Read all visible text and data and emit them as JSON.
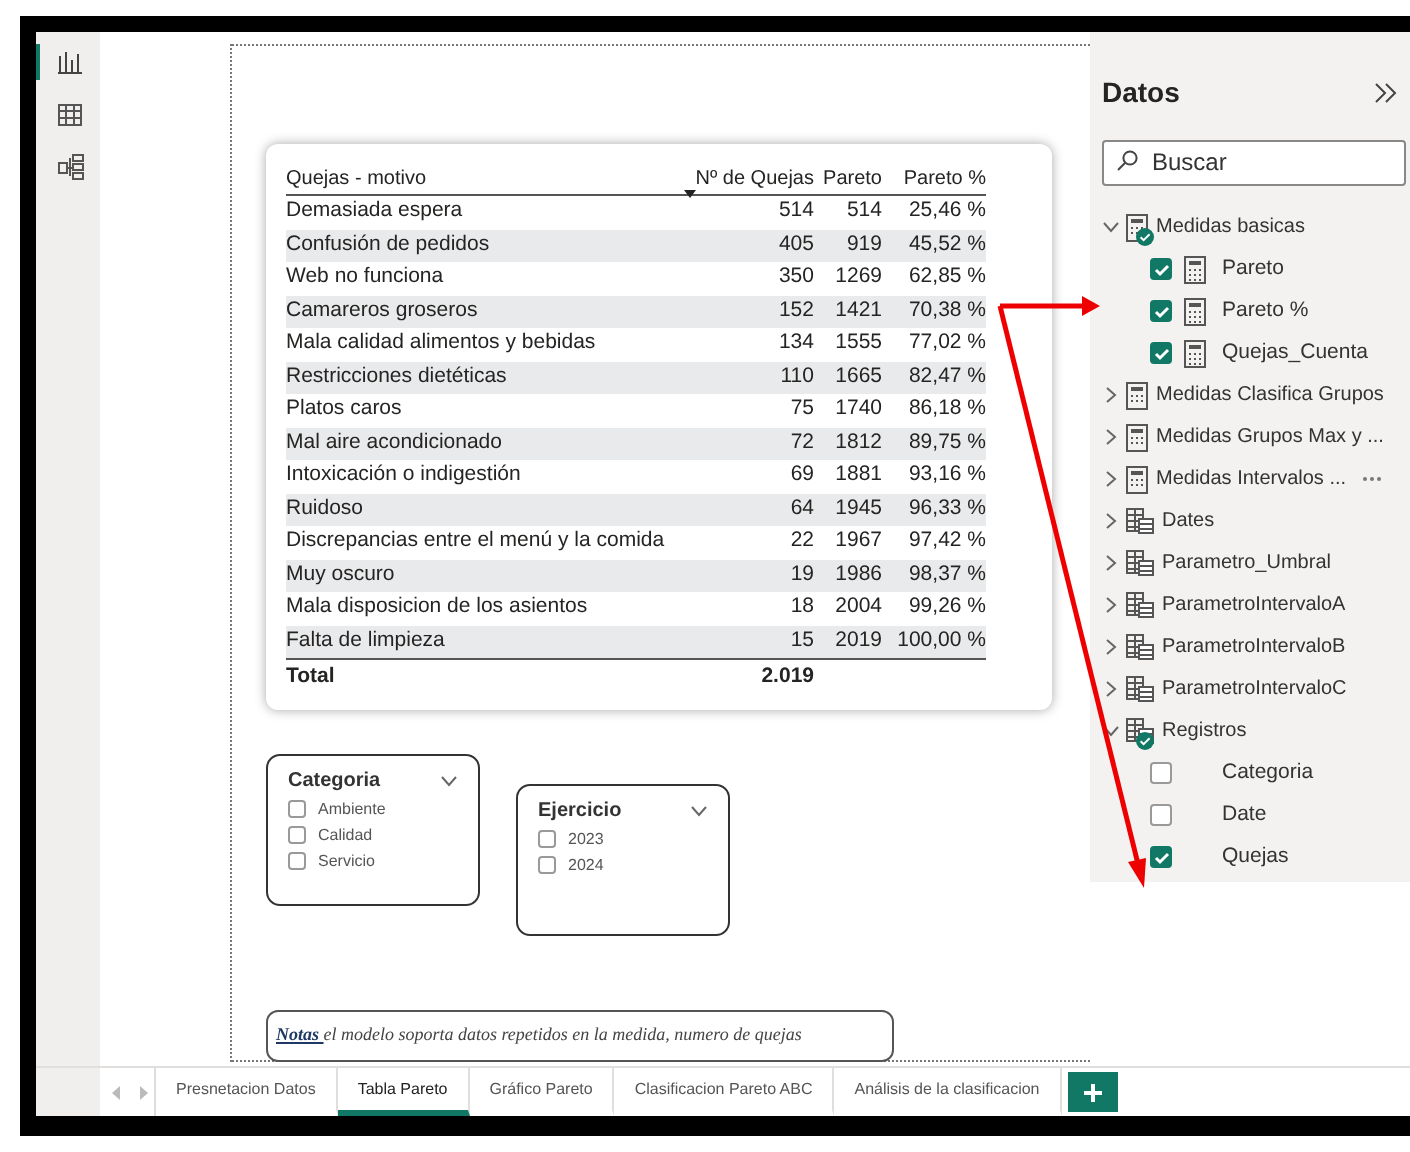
{
  "view_rail": [
    {
      "kind": "report",
      "selected": true
    },
    {
      "kind": "table",
      "selected": false
    },
    {
      "kind": "model",
      "selected": false
    }
  ],
  "table": {
    "columns": [
      "Quejas - motivo",
      "Nº de Quejas",
      "Pareto",
      "Pareto %"
    ],
    "rows": [
      [
        "Demasiada espera",
        "514",
        "514",
        "25,46 %"
      ],
      [
        "Confusión de pedidos",
        "405",
        "919",
        "45,52 %"
      ],
      [
        "Web no funciona",
        "350",
        "1269",
        "62,85 %"
      ],
      [
        "Camareros groseros",
        "152",
        "1421",
        "70,38 %"
      ],
      [
        "Mala calidad alimentos y bebidas",
        "134",
        "1555",
        "77,02 %"
      ],
      [
        "Restricciones dietéticas",
        "110",
        "1665",
        "82,47 %"
      ],
      [
        "Platos caros",
        "75",
        "1740",
        "86,18 %"
      ],
      [
        "Mal aire acondicionado",
        "72",
        "1812",
        "89,75 %"
      ],
      [
        "Intoxicación o indigestión",
        "69",
        "1881",
        "93,16 %"
      ],
      [
        "Ruidoso",
        "64",
        "1945",
        "96,33 %"
      ],
      [
        "Discrepancias entre el menú y la comida",
        "22",
        "1967",
        "97,42 %"
      ],
      [
        "Muy oscuro",
        "19",
        "1986",
        "98,37 %"
      ],
      [
        "Mala disposicion de los asientos",
        "18",
        "2004",
        "99,26 %"
      ],
      [
        "Falta de limpieza",
        "15",
        "2019",
        "100,00 %"
      ]
    ],
    "total": {
      "label": "Total",
      "value": "2.019"
    }
  },
  "slicers": [
    {
      "title": "Categoria",
      "items": [
        {
          "label": "Ambiente",
          "checked": false
        },
        {
          "label": "Calidad",
          "checked": false
        },
        {
          "label": "Servicio",
          "checked": false
        }
      ]
    },
    {
      "title": "Ejercicio",
      "items": [
        {
          "label": "2023",
          "checked": false
        },
        {
          "label": "2024",
          "checked": false
        }
      ]
    }
  ],
  "note": {
    "lead": "Notas ",
    "text": "el modelo soporta datos repetidos en la medida, numero de quejas"
  },
  "page_tabs": [
    {
      "label": "Presnetacion Datos",
      "selected": false
    },
    {
      "label": "Tabla Pareto",
      "selected": true
    },
    {
      "label": "Gráfico Pareto",
      "selected": false
    },
    {
      "label": "Clasificacion Pareto ABC",
      "selected": false
    },
    {
      "label": "Análisis de la clasificacion",
      "selected": false
    }
  ],
  "data_pane": {
    "title": "Datos",
    "search": {
      "placeholder": "Buscar"
    },
    "tree": [
      {
        "label": "Medidas basicas",
        "kind": "measures",
        "expanded": true,
        "in_use": true,
        "children": [
          {
            "label": "Pareto",
            "kind": "measure",
            "checked": true
          },
          {
            "label": "Pareto %",
            "kind": "measure",
            "checked": true
          },
          {
            "label": "Quejas_Cuenta",
            "kind": "measure",
            "checked": true
          }
        ]
      },
      {
        "label": "Medidas Clasifica Grupos",
        "kind": "measures",
        "expanded": false,
        "in_use": false
      },
      {
        "label": "Medidas Grupos Max y ...",
        "kind": "measures",
        "expanded": false,
        "in_use": false
      },
      {
        "label": "Medidas Intervalos ...",
        "kind": "measures",
        "expanded": false,
        "in_use": false,
        "more": true
      },
      {
        "label": "Dates",
        "kind": "table",
        "expanded": false,
        "in_use": false
      },
      {
        "label": "Parametro_Umbral",
        "kind": "table",
        "expanded": false,
        "in_use": false
      },
      {
        "label": "ParametroIntervaloA",
        "kind": "table",
        "expanded": false,
        "in_use": false
      },
      {
        "label": "ParametroIntervaloB",
        "kind": "table",
        "expanded": false,
        "in_use": false
      },
      {
        "label": "ParametroIntervaloC",
        "kind": "table",
        "expanded": false,
        "in_use": false
      },
      {
        "label": "Registros",
        "kind": "table",
        "expanded": true,
        "in_use": true,
        "children": [
          {
            "label": "Categoria",
            "kind": "column",
            "checked": false
          },
          {
            "label": "Date",
            "kind": "column",
            "checked": false
          },
          {
            "label": "Quejas",
            "kind": "column",
            "checked": true
          }
        ]
      }
    ]
  }
}
